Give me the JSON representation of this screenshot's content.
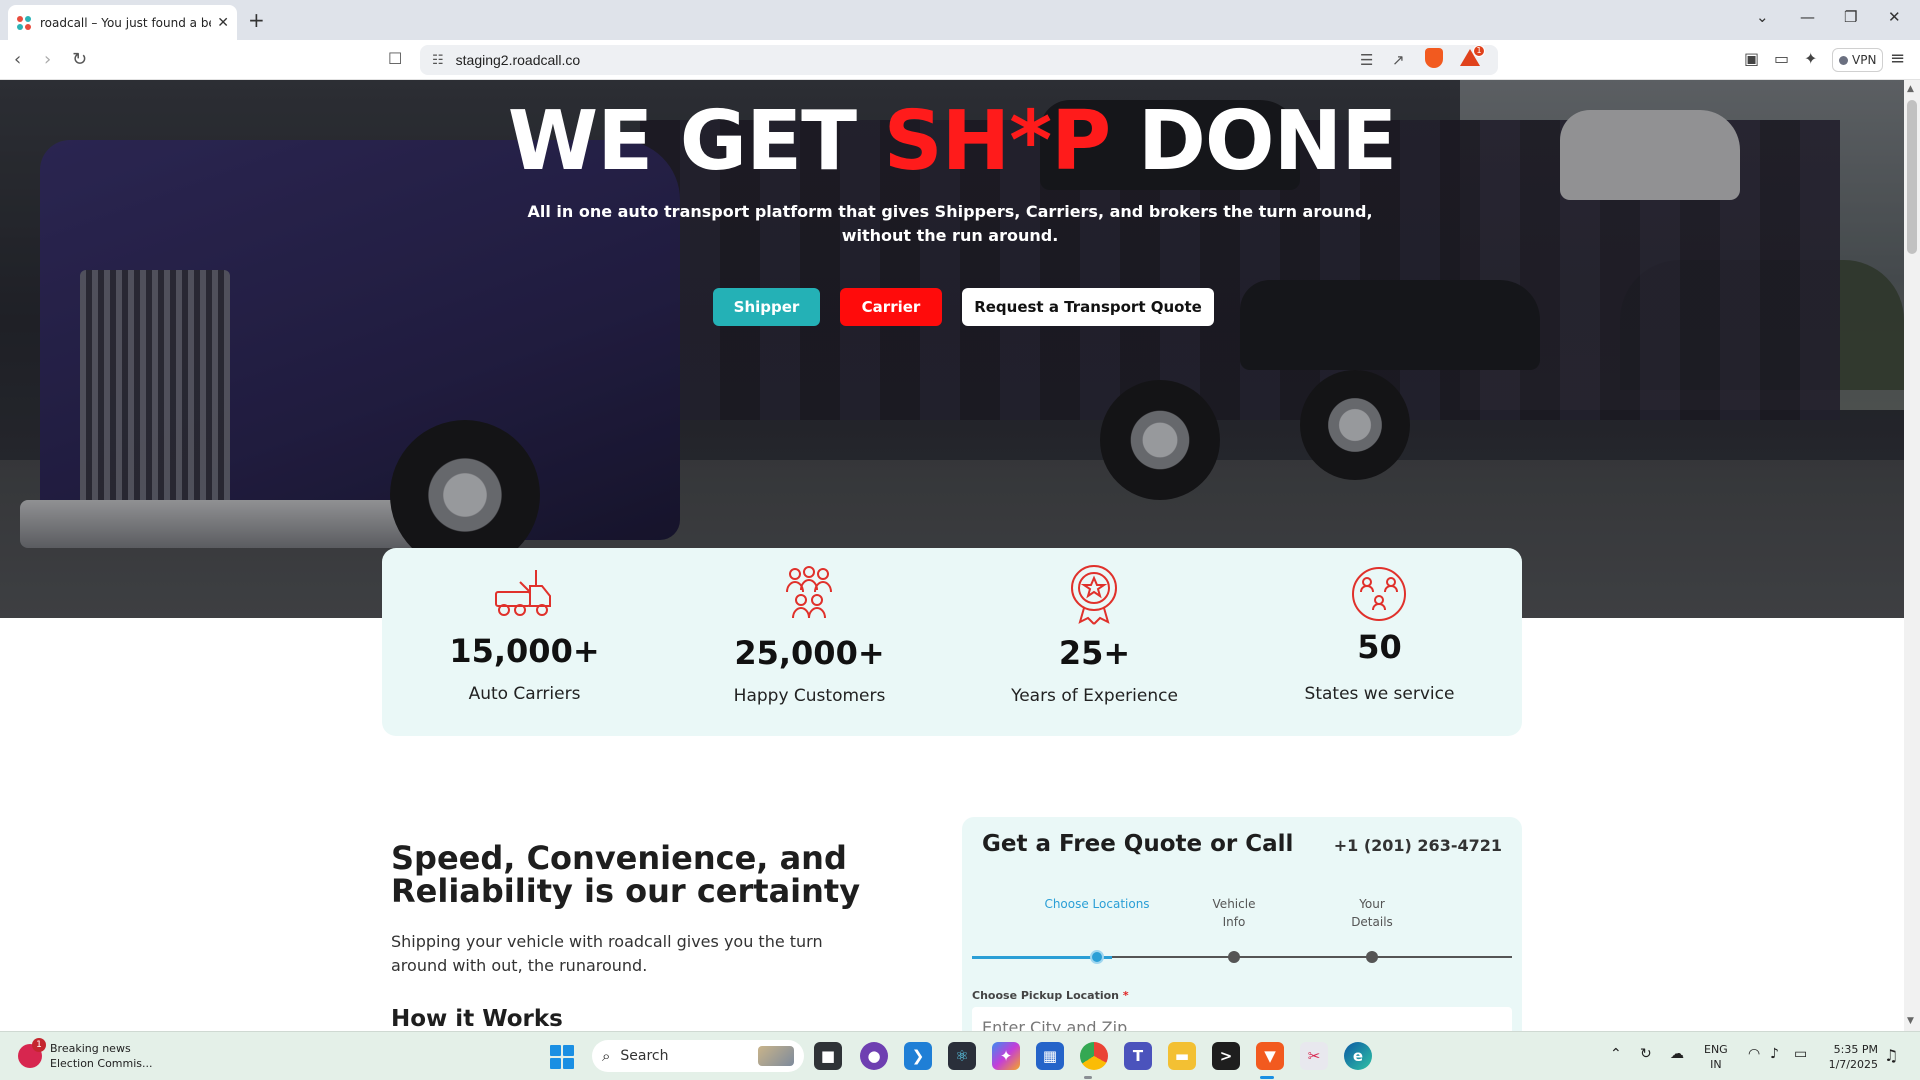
{
  "browser": {
    "tab_title": "roadcall – You just found a bett",
    "url": "staging2.roadcall.co",
    "vpn_label": "VPN",
    "rewards_badge": "1"
  },
  "hero": {
    "title_part1": "WE GET ",
    "title_accent": "SH*P",
    "title_part2": " DONE",
    "subtitle": "All in one auto transport platform that gives Shippers, Carriers, and brokers the turn around, without the run around.",
    "buttons": {
      "shipper": "Shipper",
      "carrier": "Carrier",
      "quote": "Request a Transport Quote"
    }
  },
  "stats": [
    {
      "icon": "car-carrier-truck-icon",
      "value": "15,000+",
      "label": "Auto Carriers"
    },
    {
      "icon": "people-group-icon",
      "value": "25,000+",
      "label": "Happy Customers"
    },
    {
      "icon": "award-star-icon",
      "value": "25+",
      "label": "Years of Experience"
    },
    {
      "icon": "globe-people-icon",
      "value": "50",
      "label": "States we service"
    }
  ],
  "about": {
    "title": "Speed, Convenience, and Reliability is our certainty",
    "text": "Shipping your vehicle with roadcall gives you the turn around with out, the runaround.",
    "how_title": "How it Works"
  },
  "quote_form": {
    "title": "Get a Free Quote or Call",
    "phone": "+1 (201) 263-4721",
    "steps": [
      {
        "label": "Choose Locations",
        "active": true
      },
      {
        "label": "Vehicle Info",
        "active": false
      },
      {
        "label": "Your Details",
        "active": false
      }
    ],
    "pickup_label": "Choose Pickup Location",
    "required_mark": "*",
    "pickup_placeholder": "Enter City and Zip"
  },
  "taskbar": {
    "news_title": "Breaking news",
    "news_sub": "Election Commis...",
    "news_badge": "1",
    "search_label": "Search",
    "lang_line1": "ENG",
    "lang_line2": "IN",
    "time": "5:35 PM",
    "date": "1/7/2025"
  },
  "colors": {
    "accent_red": "#ff1b1b",
    "shipper_teal": "#24b1b6",
    "carrier_red": "#ff0b0b",
    "stats_bg": "#eaf8f7",
    "step_active": "#2b9fd6"
  }
}
